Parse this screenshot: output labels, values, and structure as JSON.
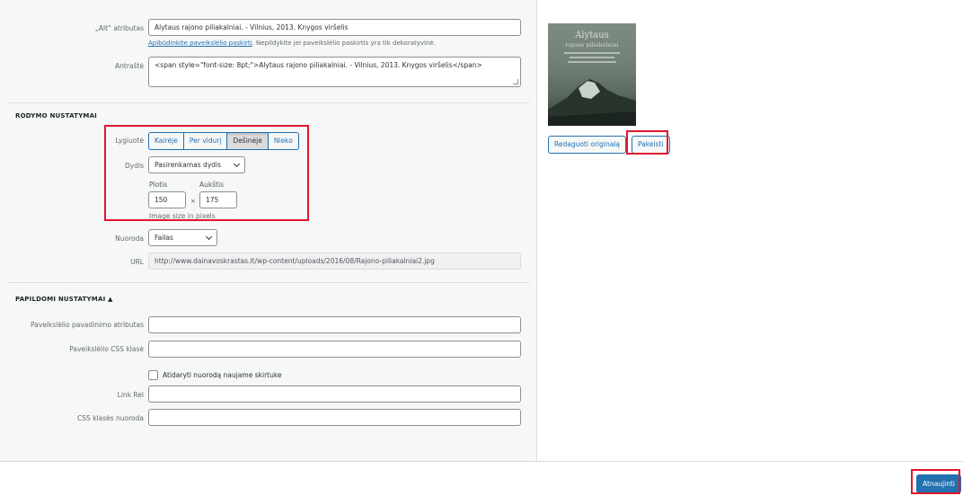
{
  "fields": {
    "alt": {
      "label": "„Alt“ atributas",
      "value": "Alytaus rajono piliakalniai. - Vilnius, 2013. Knygos viršelis",
      "help_link": "Apibūdinkite paveikslėlio paskirtį",
      "help_rest": ". Nepildykite jei paveikslėlio paskirtis yra tik dekoratyvinė."
    },
    "caption": {
      "label": "Antraštė",
      "value": "<span style=\"font-size: 8pt;\">Alytaus rajono piliakalniai. - Vilnius, 2013. Knygos viršelis</span>"
    }
  },
  "display_settings": {
    "title": "RODYMO NUSTATYMAI",
    "align": {
      "label": "Lygiuotė",
      "options": [
        "Kairėje",
        "Per vidurį",
        "Dešinėje",
        "Nieko"
      ],
      "selected": "Dešinėje"
    },
    "size": {
      "label": "Dydis",
      "value": "Pasirenkamas dydis"
    },
    "width": {
      "label": "Plotis",
      "value": "150"
    },
    "height": {
      "label": "Aukštis",
      "value": "175"
    },
    "times": "×",
    "size_note": "Image size in pixels",
    "link": {
      "label": "Nuoroda",
      "value": "Failas"
    },
    "url": {
      "label": "URL",
      "value": "http://www.dainavoskrastas.lt/wp-content/uploads/2016/08/Rajono-piliakalniai2.jpg"
    }
  },
  "advanced_settings": {
    "title": "PAPILDOMI NUSTATYMAI ▲",
    "image_title": {
      "label": "Paveikslėlio pavadinimo atributas",
      "value": ""
    },
    "image_css": {
      "label": "Paveikslėlio CSS klasė",
      "value": ""
    },
    "new_tab": {
      "label": "Atidaryti nuorodą naujame skirtuke",
      "checked": false
    },
    "link_rel": {
      "label": "Link Rel",
      "value": ""
    },
    "link_css": {
      "label": "CSS klasės nuoroda",
      "value": ""
    }
  },
  "preview": {
    "edit_original": "Redaguoti originalą",
    "replace": "Pakeisti"
  },
  "footer": {
    "update": "Atnaujinti"
  },
  "colors": {
    "accent": "#2271b1",
    "highlight": "#e0182d"
  }
}
